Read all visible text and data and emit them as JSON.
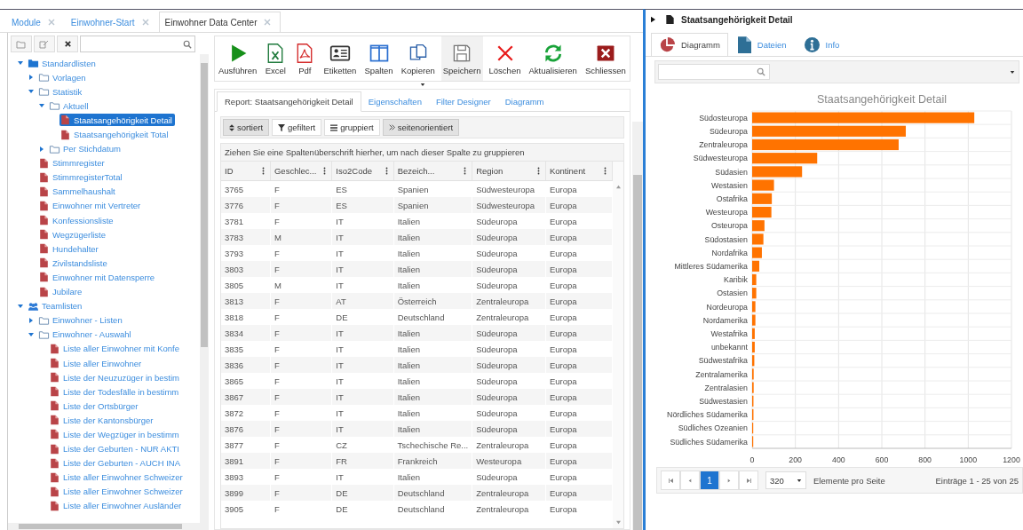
{
  "module_tabs": [
    {
      "label": "Module",
      "selected": false
    },
    {
      "label": "Einwohner-Start",
      "selected": false
    },
    {
      "label": "Einwohner Data Center",
      "selected": true
    }
  ],
  "tree": {
    "items": [
      {
        "label": "Standardlisten",
        "kind": "root",
        "expanded": true,
        "selected": false,
        "children": [
          {
            "label": "Vorlagen",
            "kind": "folder",
            "expanded": false,
            "selected": false
          },
          {
            "label": "Statistik",
            "kind": "folder",
            "expanded": true,
            "selected": false,
            "children": [
              {
                "label": "Aktuell",
                "kind": "folder",
                "expanded": true,
                "selected": false,
                "children": [
                  {
                    "label": "Staatsangehörigkeit Detail",
                    "kind": "report",
                    "selected": true
                  },
                  {
                    "label": "Staatsangehörigkeit Total",
                    "kind": "report",
                    "selected": false
                  }
                ]
              },
              {
                "label": "Per Stichdatum",
                "kind": "folder",
                "expanded": false,
                "selected": false
              }
            ]
          },
          {
            "label": "Stimmregister",
            "kind": "report",
            "selected": false
          },
          {
            "label": "StimmregisterTotal",
            "kind": "report",
            "selected": false
          },
          {
            "label": "Sammelhaushalt",
            "kind": "report",
            "selected": false
          },
          {
            "label": "Einwohner mit Vertreter",
            "kind": "report",
            "selected": false
          },
          {
            "label": "Konfessionsliste",
            "kind": "report",
            "selected": false
          },
          {
            "label": "Wegzügerliste",
            "kind": "report",
            "selected": false
          },
          {
            "label": "Hundehalter",
            "kind": "report",
            "selected": false
          },
          {
            "label": "Zivilstandsliste",
            "kind": "report",
            "selected": false
          },
          {
            "label": "Einwohner mit Datensperre",
            "kind": "report",
            "selected": false
          },
          {
            "label": "Jubilare",
            "kind": "report",
            "selected": false
          }
        ]
      },
      {
        "label": "Teamlisten",
        "kind": "team",
        "expanded": true,
        "selected": false,
        "children": [
          {
            "label": "Einwohner - Listen",
            "kind": "folder",
            "expanded": false,
            "selected": false
          },
          {
            "label": "Einwohner - Auswahl",
            "kind": "folder",
            "expanded": true,
            "selected": false,
            "children": [
              {
                "label": "Liste aller Einwohner mit Konfe",
                "kind": "report",
                "selected": false
              },
              {
                "label": "Liste aller Einwohner",
                "kind": "report",
                "selected": false
              },
              {
                "label": "Liste der Neuzuzüger in bestim",
                "kind": "report",
                "selected": false
              },
              {
                "label": "Liste der Todesfälle in bestimm",
                "kind": "report",
                "selected": false
              },
              {
                "label": "Liste der Ortsbürger",
                "kind": "report",
                "selected": false
              },
              {
                "label": "Liste der Kantonsbürger",
                "kind": "report",
                "selected": false
              },
              {
                "label": "Liste der Wegzüger in bestimm",
                "kind": "report",
                "selected": false
              },
              {
                "label": "Liste der Geburten - NUR AKTI",
                "kind": "report",
                "selected": false
              },
              {
                "label": "Liste der Geburten - AUCH INA",
                "kind": "report",
                "selected": false
              },
              {
                "label": "Liste aller Einwohner Schweizer",
                "kind": "report",
                "selected": false
              },
              {
                "label": "Liste aller Einwohner Schweizer",
                "kind": "report",
                "selected": false
              },
              {
                "label": "Liste aller Einwohner Ausländer",
                "kind": "report",
                "selected": false
              }
            ]
          }
        ]
      }
    ]
  },
  "toolbar": [
    {
      "label": "Ausführen",
      "kind": "run",
      "disabled": false
    },
    {
      "label": "Excel",
      "kind": "excel",
      "disabled": false
    },
    {
      "label": "Pdf",
      "kind": "pdf",
      "disabled": false
    },
    {
      "label": "Etiketten",
      "kind": "labels",
      "disabled": false
    },
    {
      "label": "Spalten",
      "kind": "columns",
      "disabled": false
    },
    {
      "label": "Kopieren",
      "kind": "copy",
      "disabled": false
    },
    {
      "label": "Speichern",
      "kind": "save",
      "disabled": true
    },
    {
      "label": "Löschen",
      "kind": "delete",
      "disabled": false
    },
    {
      "label": "Aktualisieren",
      "kind": "refresh",
      "disabled": false
    },
    {
      "label": "Schliessen",
      "kind": "close",
      "disabled": false
    }
  ],
  "report_tabs": [
    {
      "label": "Report: Staatsangehörigkeit Detail",
      "selected": true
    },
    {
      "label": "Eigenschaften",
      "selected": false
    },
    {
      "label": "Filter Designer",
      "selected": false
    },
    {
      "label": "Diagramm",
      "selected": false
    }
  ],
  "view_options": [
    {
      "label": "sortiert",
      "kind": "sort",
      "on": true
    },
    {
      "label": "gefiltert",
      "kind": "filter",
      "on": false
    },
    {
      "label": "gruppiert",
      "kind": "group",
      "on": false
    },
    {
      "label": "seitenorientiert",
      "kind": "paging",
      "on": true
    }
  ],
  "table": {
    "group_hint": "Ziehen Sie eine Spaltenüberschrift hierher, um nach dieser Spalte zu gruppieren",
    "columns": [
      "ID",
      "Geschlec...",
      "Iso2Code",
      "Bezeich...",
      "Region",
      "Kontinent"
    ],
    "rows": [
      [
        "3765",
        "F",
        "ES",
        "Spanien",
        "Südwesteuropa",
        "Europa"
      ],
      [
        "3776",
        "F",
        "ES",
        "Spanien",
        "Südwesteuropa",
        "Europa"
      ],
      [
        "3781",
        "F",
        "IT",
        "Italien",
        "Südeuropa",
        "Europa"
      ],
      [
        "3783",
        "M",
        "IT",
        "Italien",
        "Südeuropa",
        "Europa"
      ],
      [
        "3793",
        "F",
        "IT",
        "Italien",
        "Südeuropa",
        "Europa"
      ],
      [
        "3803",
        "F",
        "IT",
        "Italien",
        "Südeuropa",
        "Europa"
      ],
      [
        "3805",
        "M",
        "IT",
        "Italien",
        "Südeuropa",
        "Europa"
      ],
      [
        "3813",
        "F",
        "AT",
        "Österreich",
        "Zentraleuropa",
        "Europa"
      ],
      [
        "3818",
        "F",
        "DE",
        "Deutschland",
        "Zentraleuropa",
        "Europa"
      ],
      [
        "3834",
        "F",
        "IT",
        "Italien",
        "Südeuropa",
        "Europa"
      ],
      [
        "3835",
        "F",
        "IT",
        "Italien",
        "Südeuropa",
        "Europa"
      ],
      [
        "3836",
        "F",
        "IT",
        "Italien",
        "Südeuropa",
        "Europa"
      ],
      [
        "3865",
        "F",
        "IT",
        "Italien",
        "Südeuropa",
        "Europa"
      ],
      [
        "3867",
        "F",
        "IT",
        "Italien",
        "Südeuropa",
        "Europa"
      ],
      [
        "3872",
        "F",
        "IT",
        "Italien",
        "Südeuropa",
        "Europa"
      ],
      [
        "3876",
        "F",
        "IT",
        "Italien",
        "Südeuropa",
        "Europa"
      ],
      [
        "3877",
        "F",
        "CZ",
        "Tschechische Re...",
        "Zentraleuropa",
        "Europa"
      ],
      [
        "3891",
        "F",
        "FR",
        "Frankreich",
        "Westeuropa",
        "Europa"
      ],
      [
        "3893",
        "F",
        "IT",
        "Italien",
        "Südeuropa",
        "Europa"
      ],
      [
        "3899",
        "F",
        "DE",
        "Deutschland",
        "Zentraleuropa",
        "Europa"
      ],
      [
        "3905",
        "F",
        "DE",
        "Deutschland",
        "Zentraleuropa",
        "Europa"
      ]
    ]
  },
  "detail": {
    "title": "Staatsangehörigkeit Detail",
    "tabs": [
      {
        "label": "Diagramm",
        "kind": "chart",
        "selected": true
      },
      {
        "label": "Dateien",
        "kind": "files",
        "selected": false
      },
      {
        "label": "Info",
        "kind": "info",
        "selected": false
      }
    ],
    "chart_data": {
      "type": "bar",
      "orientation": "horizontal",
      "title": "Staatsangehörigkeit Detail",
      "categories": [
        "Südosteuropa",
        "Südeuropa",
        "Zentraleuropa",
        "Südwesteuropa",
        "Südasien",
        "Westasien",
        "Ostafrika",
        "Westeuropa",
        "Osteuropa",
        "Südostasien",
        "Nordafrika",
        "Mittleres Südamerika",
        "Karibik",
        "Ostasien",
        "Nordeuropa",
        "Nordamerika",
        "Westafrika",
        "unbekannt",
        "Südwestafrika",
        "Zentralamerika",
        "Zentralasien",
        "Südwestasien",
        "Nördliches Südamerika",
        "Südliches Ozeanien",
        "Südliches Südamerika"
      ],
      "series": [
        {
          "color": "#ff7300",
          "values": [
            1028,
            711,
            678,
            301,
            231,
            101,
            91,
            89,
            57,
            52,
            45,
            33,
            19,
            19,
            15,
            15,
            12,
            12,
            10,
            7,
            7,
            6,
            6,
            5,
            5
          ]
        }
      ],
      "grid": true,
      "xlim": [
        0,
        1200
      ],
      "xticks": [
        0,
        200,
        400,
        600,
        800,
        1000,
        1200
      ]
    },
    "pager": {
      "pages": [
        {
          "label": "1",
          "selected": true
        }
      ],
      "page_size": "320",
      "page_size_label": "Elemente pro Seite",
      "summary": "Einträge 1 - 25 von 25"
    }
  }
}
